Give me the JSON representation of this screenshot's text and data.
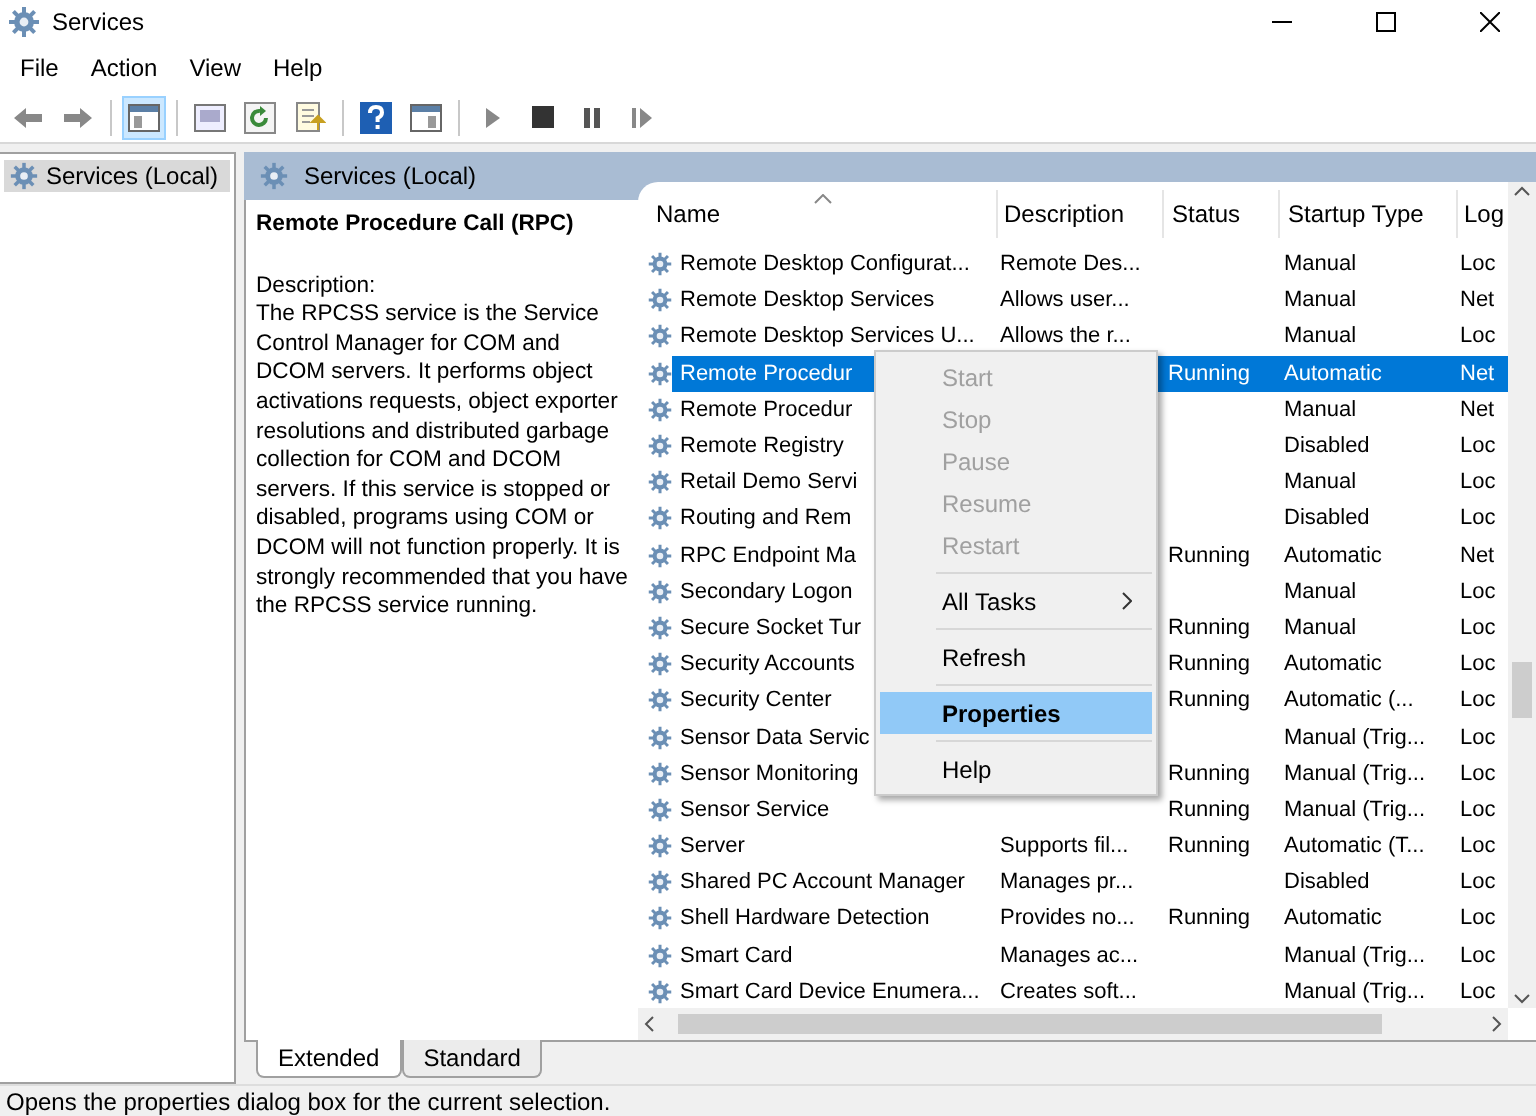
{
  "window": {
    "title": "Services"
  },
  "menu_bar": [
    "File",
    "Action",
    "View",
    "Help"
  ],
  "toolbar": [
    {
      "kind": "back",
      "active": false
    },
    {
      "kind": "forward",
      "active": false
    },
    {
      "kind": "separator"
    },
    {
      "kind": "console-tree",
      "active": true
    },
    {
      "kind": "separator"
    },
    {
      "kind": "sheet",
      "active": false
    },
    {
      "kind": "refresh",
      "active": false
    },
    {
      "kind": "export",
      "active": false
    },
    {
      "kind": "separator"
    },
    {
      "kind": "help",
      "active": false
    },
    {
      "kind": "pane",
      "active": false
    },
    {
      "kind": "separator"
    },
    {
      "kind": "play",
      "active": false
    },
    {
      "kind": "stop",
      "active": false
    },
    {
      "kind": "pause",
      "active": false
    },
    {
      "kind": "resume",
      "active": false
    }
  ],
  "tree": [
    {
      "label": "Services (Local)",
      "selected": true
    }
  ],
  "panel": {
    "title": "Services (Local)"
  },
  "details": {
    "title": "Remote Procedure Call (RPC)",
    "description_label": "Description:",
    "description": "The RPCSS service is the Service Control Manager for COM and DCOM servers. It performs object activations requests, object exporter resolutions and distributed garbage collection for COM and DCOM servers. If this service is stopped or disabled, programs using COM or DCOM will not function properly. It is strongly recommended that you have the RPCSS service running."
  },
  "table": {
    "columns": [
      "Name",
      "Description",
      "Status",
      "Startup Type",
      "Log"
    ],
    "rows": [
      {
        "name": "Remote Desktop Configurat...",
        "description": "Remote Des...",
        "status": "",
        "startup": "Manual",
        "log": "Loc",
        "selected": false
      },
      {
        "name": "Remote Desktop Services",
        "description": "Allows user...",
        "status": "",
        "startup": "Manual",
        "log": "Net",
        "selected": false
      },
      {
        "name": "Remote Desktop Services U...",
        "description": "Allows the r...",
        "status": "",
        "startup": "Manual",
        "log": "Loc",
        "selected": false
      },
      {
        "name": "Remote Procedur",
        "description": "",
        "status": "Running",
        "startup": "Automatic",
        "log": "Net",
        "selected": true
      },
      {
        "name": "Remote Procedur",
        "description": "",
        "status": "",
        "startup": "Manual",
        "log": "Net",
        "selected": false
      },
      {
        "name": "Remote Registry",
        "description": "",
        "status": "",
        "startup": "Disabled",
        "log": "Loc",
        "selected": false
      },
      {
        "name": "Retail Demo Servi",
        "description": "",
        "status": "",
        "startup": "Manual",
        "log": "Loc",
        "selected": false
      },
      {
        "name": "Routing and Rem",
        "description": "",
        "status": "",
        "startup": "Disabled",
        "log": "Loc",
        "selected": false
      },
      {
        "name": "RPC Endpoint Ma",
        "description": "",
        "status": "Running",
        "startup": "Automatic",
        "log": "Net",
        "selected": false
      },
      {
        "name": "Secondary Logon",
        "description": "",
        "status": "",
        "startup": "Manual",
        "log": "Loc",
        "selected": false
      },
      {
        "name": "Secure Socket Tur",
        "description": "",
        "status": "Running",
        "startup": "Manual",
        "log": "Loc",
        "selected": false
      },
      {
        "name": "Security Accounts",
        "description": "",
        "status": "Running",
        "startup": "Automatic",
        "log": "Loc",
        "selected": false
      },
      {
        "name": "Security Center",
        "description": "",
        "status": "Running",
        "startup": "Automatic (...",
        "log": "Loc",
        "selected": false
      },
      {
        "name": "Sensor Data Servic",
        "description": "",
        "status": "",
        "startup": "Manual (Trig...",
        "log": "Loc",
        "selected": false
      },
      {
        "name": "Sensor Monitoring",
        "description": "",
        "status": "Running",
        "startup": "Manual (Trig...",
        "log": "Loc",
        "selected": false
      },
      {
        "name": "Sensor Service",
        "description": "",
        "status": "Running",
        "startup": "Manual (Trig...",
        "log": "Loc",
        "selected": false
      },
      {
        "name": "Server",
        "description": "Supports fil...",
        "status": "Running",
        "startup": "Automatic (T...",
        "log": "Loc",
        "selected": false
      },
      {
        "name": "Shared PC Account Manager",
        "description": "Manages pr...",
        "status": "",
        "startup": "Disabled",
        "log": "Loc",
        "selected": false
      },
      {
        "name": "Shell Hardware Detection",
        "description": "Provides no...",
        "status": "Running",
        "startup": "Automatic",
        "log": "Loc",
        "selected": false
      },
      {
        "name": "Smart Card",
        "description": "Manages ac...",
        "status": "",
        "startup": "Manual (Trig...",
        "log": "Loc",
        "selected": false
      },
      {
        "name": "Smart Card Device Enumera...",
        "description": "Creates soft...",
        "status": "",
        "startup": "Manual (Trig...",
        "log": "Loc",
        "selected": false
      }
    ]
  },
  "context_menu": [
    {
      "kind": "item",
      "label": "Start",
      "disabled": true,
      "highlighted": false,
      "submenu": false
    },
    {
      "kind": "item",
      "label": "Stop",
      "disabled": true,
      "highlighted": false,
      "submenu": false
    },
    {
      "kind": "item",
      "label": "Pause",
      "disabled": true,
      "highlighted": false,
      "submenu": false
    },
    {
      "kind": "item",
      "label": "Resume",
      "disabled": true,
      "highlighted": false,
      "submenu": false
    },
    {
      "kind": "item",
      "label": "Restart",
      "disabled": true,
      "highlighted": false,
      "submenu": false
    },
    {
      "kind": "separator"
    },
    {
      "kind": "item",
      "label": "All Tasks",
      "disabled": false,
      "highlighted": false,
      "submenu": true
    },
    {
      "kind": "separator"
    },
    {
      "kind": "item",
      "label": "Refresh",
      "disabled": false,
      "highlighted": false,
      "submenu": false
    },
    {
      "kind": "separator"
    },
    {
      "kind": "item",
      "label": "Properties",
      "disabled": false,
      "highlighted": true,
      "submenu": false
    },
    {
      "kind": "separator"
    },
    {
      "kind": "item",
      "label": "Help",
      "disabled": false,
      "highlighted": false,
      "submenu": false
    }
  ],
  "tabs": [
    {
      "label": "Extended",
      "selected": true
    },
    {
      "label": "Standard",
      "selected": false
    }
  ],
  "status_bar": "Opens the properties dialog box for the current selection."
}
